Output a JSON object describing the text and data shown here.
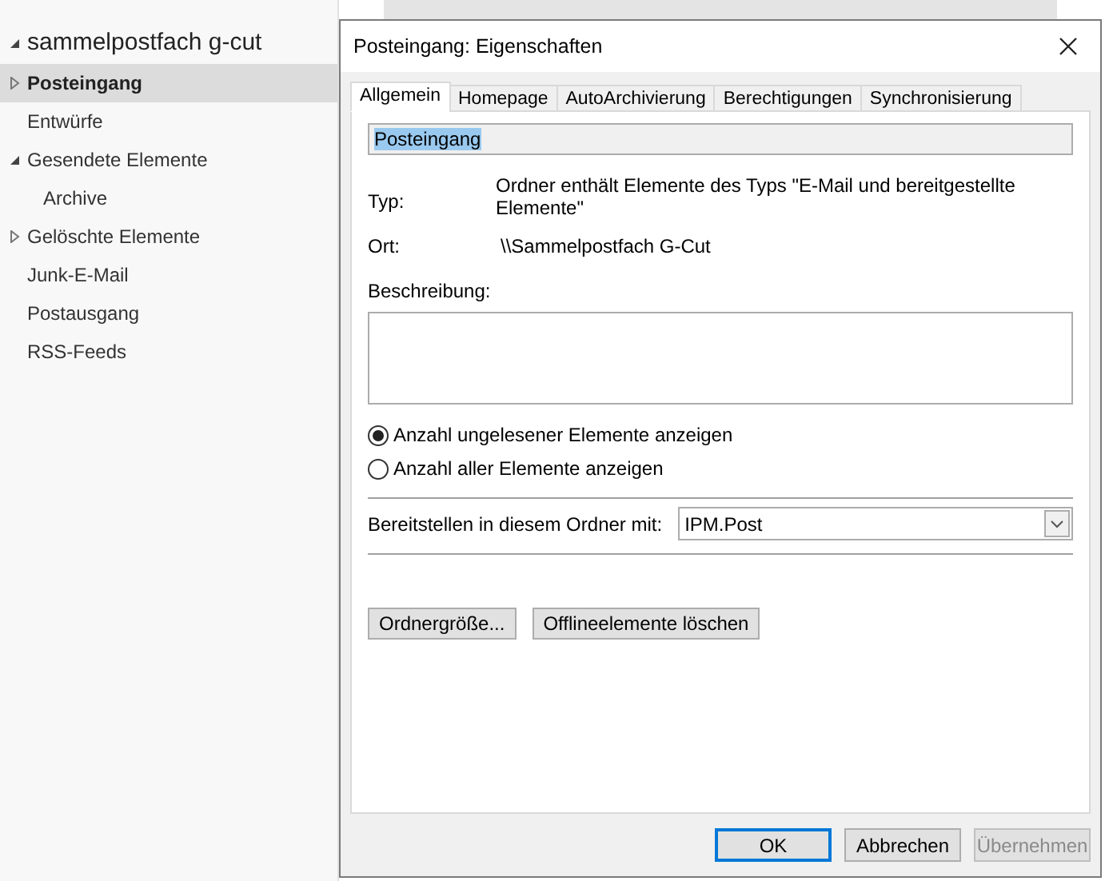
{
  "sidebar": {
    "account": {
      "label": "sammelpostfach g-cut",
      "expanded": true
    },
    "folders": [
      {
        "label": "Posteingang",
        "selected": true,
        "expanded": false
      },
      {
        "label": "Entwürfe",
        "selected": false
      },
      {
        "label": "Gesendete Elemente",
        "selected": false,
        "expanded": true,
        "children": [
          {
            "label": "Archive",
            "selected": false
          }
        ]
      },
      {
        "label": "Gelöschte Elemente",
        "selected": false,
        "expanded": false
      },
      {
        "label": "Junk-E-Mail",
        "selected": false
      },
      {
        "label": "Postausgang",
        "selected": false
      },
      {
        "label": "RSS-Feeds",
        "selected": false
      }
    ]
  },
  "dialog": {
    "title": "Posteingang: Eigenschaften",
    "tabs": [
      {
        "label": "Allgemein",
        "selected": true
      },
      {
        "label": "Homepage",
        "selected": false
      },
      {
        "label": "AutoArchivierung",
        "selected": false
      },
      {
        "label": "Berechtigungen",
        "selected": false
      },
      {
        "label": "Synchronisierung",
        "selected": false
      }
    ],
    "name_value": "Posteingang",
    "type_label": "Typ:",
    "type_value": "Ordner enthält Elemente des Typs \"E-Mail und bereitgestellte Elemente\"",
    "location_label": "Ort:",
    "location_value": "\\\\Sammelpostfach G-Cut",
    "description_label": "Beschreibung:",
    "radios": [
      {
        "label": "Anzahl ungelesener Elemente anzeigen",
        "selected": true
      },
      {
        "label": "Anzahl aller Elemente anzeigen",
        "selected": false
      }
    ],
    "post_label": "Bereitstellen in diesem Ordner mit:",
    "post_value": "IPM.Post",
    "action_buttons": [
      {
        "label": "Ordnergröße..."
      },
      {
        "label": "Offlineelemente löschen"
      }
    ],
    "footer_buttons": [
      {
        "label": "OK",
        "default": true,
        "disabled": false
      },
      {
        "label": "Abbrechen",
        "default": false,
        "disabled": false
      },
      {
        "label": "Übernehmen",
        "default": false,
        "disabled": true
      }
    ]
  }
}
